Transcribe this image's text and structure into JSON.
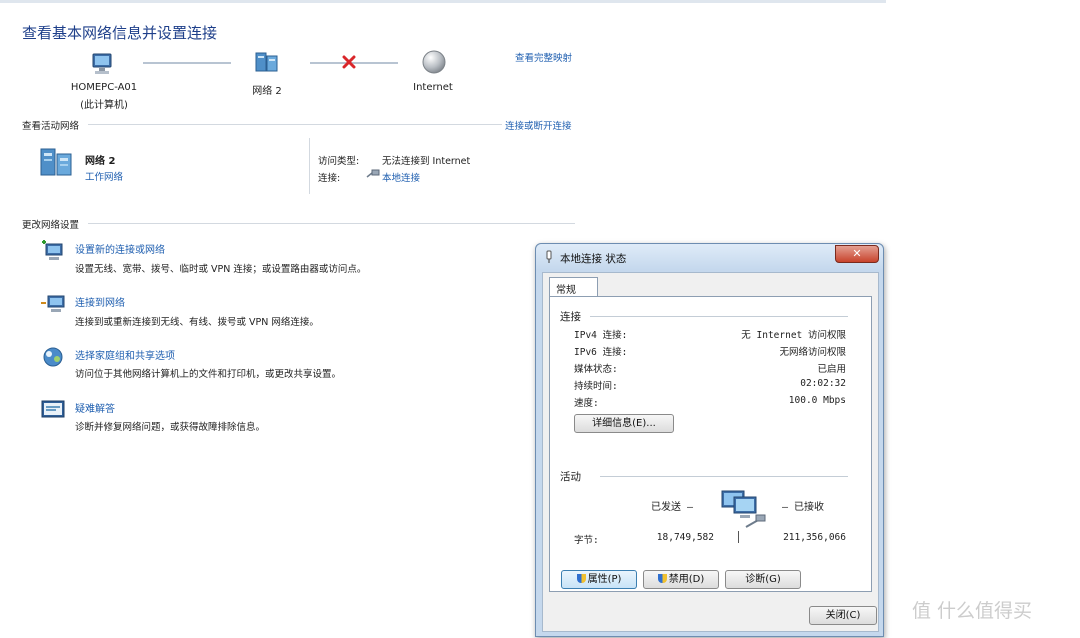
{
  "page": {
    "title": "查看基本网络信息并设置连接",
    "view_map_link": "查看完整映射"
  },
  "network_map": {
    "computer": {
      "name": "HOMEPC-A01",
      "sub": "(此计算机)"
    },
    "network": {
      "name": "网络  2"
    },
    "internet": {
      "name": "Internet"
    }
  },
  "active_networks": {
    "header": "查看活动网络",
    "connect_link": "连接或断开连接",
    "network_name": "网络  2",
    "network_type": "工作网络",
    "access_type_label": "访问类型:",
    "access_type_value": "无法连接到 Internet",
    "connection_label": "连接:",
    "connection_value": "本地连接"
  },
  "change_settings": {
    "header": "更改网络设置",
    "tasks": [
      {
        "title": "设置新的连接或网络",
        "desc": "设置无线、宽带、拨号、临时或 VPN 连接；或设置路由器或访问点。"
      },
      {
        "title": "连接到网络",
        "desc": "连接到或重新连接到无线、有线、拨号或 VPN 网络连接。"
      },
      {
        "title": "选择家庭组和共享选项",
        "desc": "访问位于其他网络计算机上的文件和打印机，或更改共享设置。"
      },
      {
        "title": "疑难解答",
        "desc": "诊断并修复网络问题，或获得故障排除信息。"
      }
    ]
  },
  "dialog": {
    "title": "本地连接 状态",
    "close_glyph": "✕",
    "tab": "常规",
    "connection_group": "连接",
    "rows": [
      {
        "key": "IPv4 连接:",
        "value": "无 Internet 访问权限"
      },
      {
        "key": "IPv6 连接:",
        "value": "无网络访问权限"
      },
      {
        "key": "媒体状态:",
        "value": "已启用"
      },
      {
        "key": "持续时间:",
        "value": "02:02:32"
      },
      {
        "key": "速度:",
        "value": "100.0 Mbps"
      }
    ],
    "details_button": "详细信息(E)...",
    "activity_group": "活动",
    "sent_label": "已发送 —",
    "received_label": "— 已接收",
    "bytes_label": "字节:",
    "bytes_sent": "18,749,582",
    "bytes_received": "211,356,066",
    "properties_button": "属性(P)",
    "disable_button": "禁用(D)",
    "diagnose_button": "诊断(G)",
    "close_button": "关闭(C)"
  },
  "watermark": "值 什么值得买"
}
